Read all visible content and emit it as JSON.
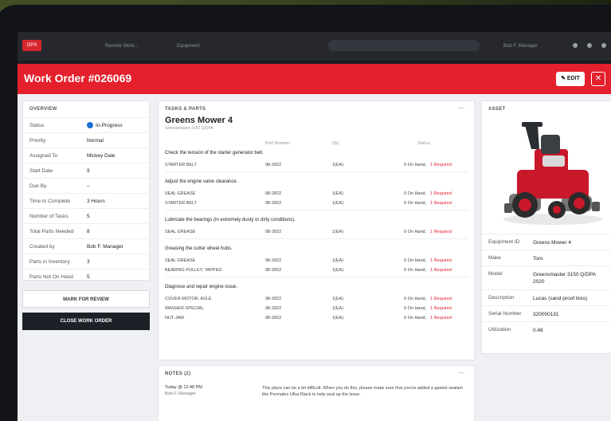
{
  "browser": {
    "favicon": "OPS",
    "tabs": [
      "Remote Work...",
      "Equipment",
      ""
    ],
    "address": "",
    "profile": "Bob F. Manager"
  },
  "header": {
    "title": "Work Order #026069",
    "edit_label": "EDIT",
    "close_label": "✕"
  },
  "overview": {
    "title": "OVERVIEW",
    "rows": [
      {
        "k": "Status",
        "v": "In-Progress"
      },
      {
        "k": "Priority",
        "v": "Normal"
      },
      {
        "k": "Assigned To",
        "v": "Mickey Dale"
      },
      {
        "k": "Start Date",
        "v": "9"
      },
      {
        "k": "Due By",
        "v": "–"
      },
      {
        "k": "Time to Complete",
        "v": "3 Hours"
      },
      {
        "k": "Number of Tasks",
        "v": "5"
      },
      {
        "k": "Total Parts Needed",
        "v": "8"
      },
      {
        "k": "Created by",
        "v": "Bob F. Manager"
      },
      {
        "k": "Parts in Inventory",
        "v": "3"
      },
      {
        "k": "Parts Not On Hand",
        "v": "5"
      }
    ],
    "review_label": "MARK FOR REVIEW",
    "close_label": "CLOSE WORK ORDER"
  },
  "tasks": {
    "section_title": "TASKS & PARTS",
    "equipment_name": "Greens Mower 4",
    "subtitle": "Greensmaster 3150 Q/DPA",
    "headers": [
      "Part Number",
      "Qty",
      "Status"
    ],
    "groups": [
      {
        "title": "Check the tension of the starter generator belt.",
        "parts": [
          {
            "name": "STARTER BELT",
            "num": "98-2822",
            "qty": "1(EA)",
            "onhand": "0 On Hand,",
            "req": "1 Required"
          }
        ]
      },
      {
        "title": "Adjust the engine valve clearance.",
        "parts": [
          {
            "name": "SEAL GREASE",
            "num": "98-2822",
            "qty": "1(EA)",
            "onhand": "0 On Hand,",
            "req": "1 Required"
          },
          {
            "name": "STARTER BELT",
            "num": "98-2822",
            "qty": "1(EA)",
            "onhand": "0 On Hand,",
            "req": "1 Required"
          }
        ]
      },
      {
        "title": "Lubricate the bearings (in extremely dusty or dirty conditions).",
        "parts": [
          {
            "name": "SEAL GREASE",
            "num": "98-2822",
            "qty": "1(EA)",
            "onhand": "0 On Hand,",
            "req": "1 Required"
          }
        ]
      },
      {
        "title": "Greasing the cutter wheel hubs.",
        "parts": [
          {
            "name": "SEAL GREASE",
            "num": "98-2822",
            "qty": "1(EA)",
            "onhand": "0 On Hand,",
            "req": "1 Required"
          },
          {
            "name": "BEARING PULLEY, TAPPED",
            "num": "98-2822",
            "qty": "1(EA)",
            "onhand": "0 On Hand,",
            "req": "1 Required"
          }
        ]
      },
      {
        "title": "Diagnose and repair engine issue.",
        "parts": [
          {
            "name": "COVER-MOTOR, AXLE",
            "num": "98-2822",
            "qty": "1(EA)",
            "onhand": "0 On Hand,",
            "req": "1 Required"
          },
          {
            "name": "WASHER-SPECIAL",
            "num": "98-2822",
            "qty": "1(EA)",
            "onhand": "0 On Hand,",
            "req": "1 Required"
          },
          {
            "name": "NUT-JAM",
            "num": "98-2822",
            "qty": "1(EA)",
            "onhand": "0 On Hand,",
            "req": "1 Required"
          }
        ]
      }
    ]
  },
  "notes": {
    "section_title": "NOTES (2)",
    "author_date": "Today @ 12:48 PM",
    "author": "Bob F. Manager",
    "text": "This place can be a bit difficult. When you do this, please make sure that you've added a gasket sealant like Permatex Ultra Black to help seal up the issue."
  },
  "asset": {
    "section_title": "ASSET",
    "rows": [
      {
        "k": "Equipment ID",
        "v": "Greens Mower 4"
      },
      {
        "k": "Make",
        "v": "Toro"
      },
      {
        "k": "Model",
        "v": "Greensmaster 3150 Q/DPA 2020"
      },
      {
        "k": "Description",
        "v": "Lucas (sand proof tires)"
      },
      {
        "k": "Serial Number",
        "v": "320000131"
      },
      {
        "k": "Utilization",
        "v": "0.48"
      }
    ]
  },
  "colors": {
    "brand": "#e4202d",
    "dark": "#1c2027",
    "link": "#1a6fd1"
  }
}
